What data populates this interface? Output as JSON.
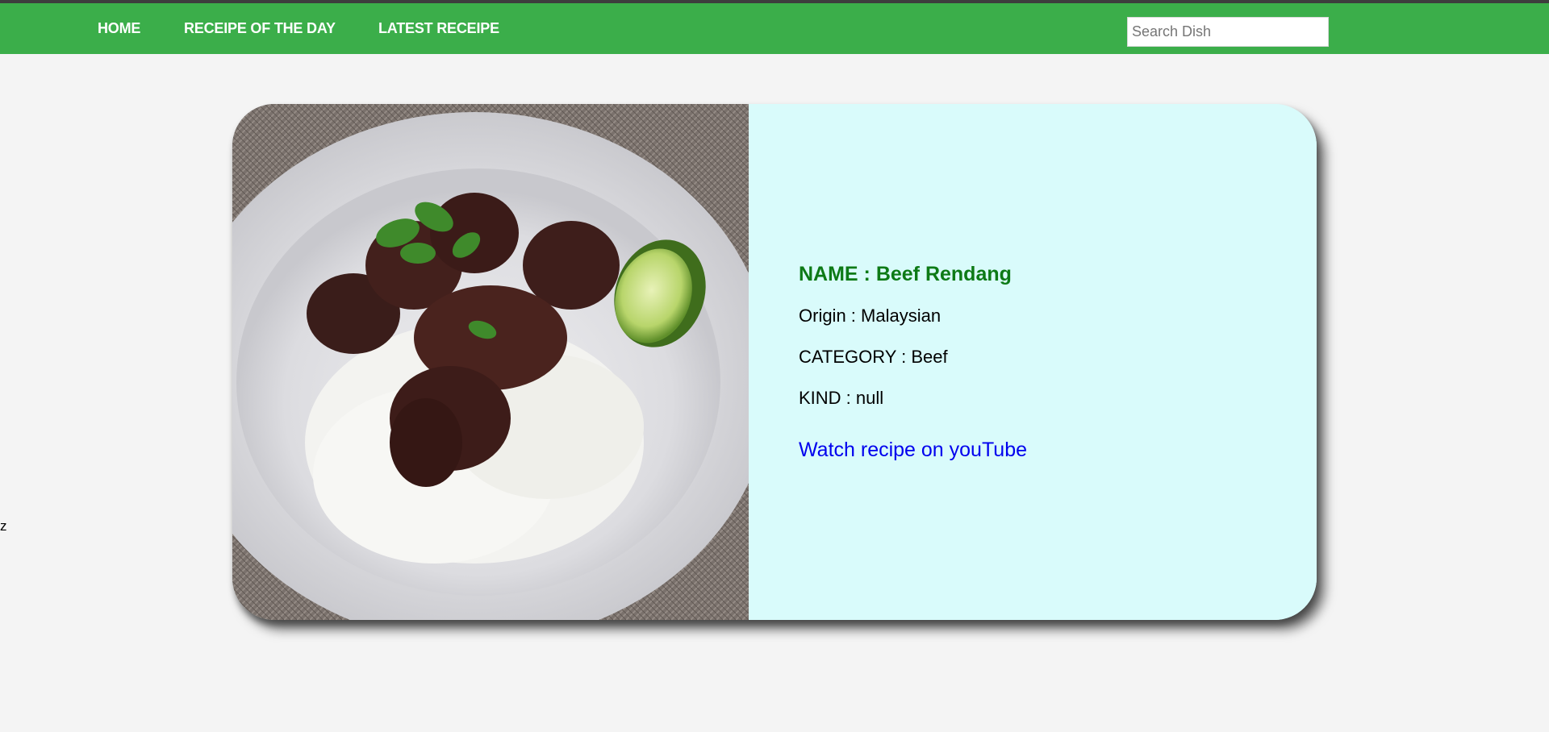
{
  "nav": {
    "items": [
      {
        "label": "HOME"
      },
      {
        "label": "RECEIPE OF THE DAY"
      },
      {
        "label": "LATEST RECEIPE"
      }
    ],
    "search_placeholder": "Search Dish"
  },
  "stray_text": "z",
  "recipe": {
    "image_alt": "Beef Rendang on rice with lime",
    "name_line": "NAME : Beef Rendang",
    "origin_line": "Origin : Malaysian",
    "category_line": "CATEGORY : Beef",
    "kind_line": "KIND : null",
    "youtube_label": "Watch recipe on youTube"
  },
  "colors": {
    "nav_bg": "#3bae4a",
    "page_bg": "#f4f4f4",
    "card_info_bg": "#d9fbfb",
    "name_color": "#0d7a16",
    "link_color": "#0000ee"
  }
}
